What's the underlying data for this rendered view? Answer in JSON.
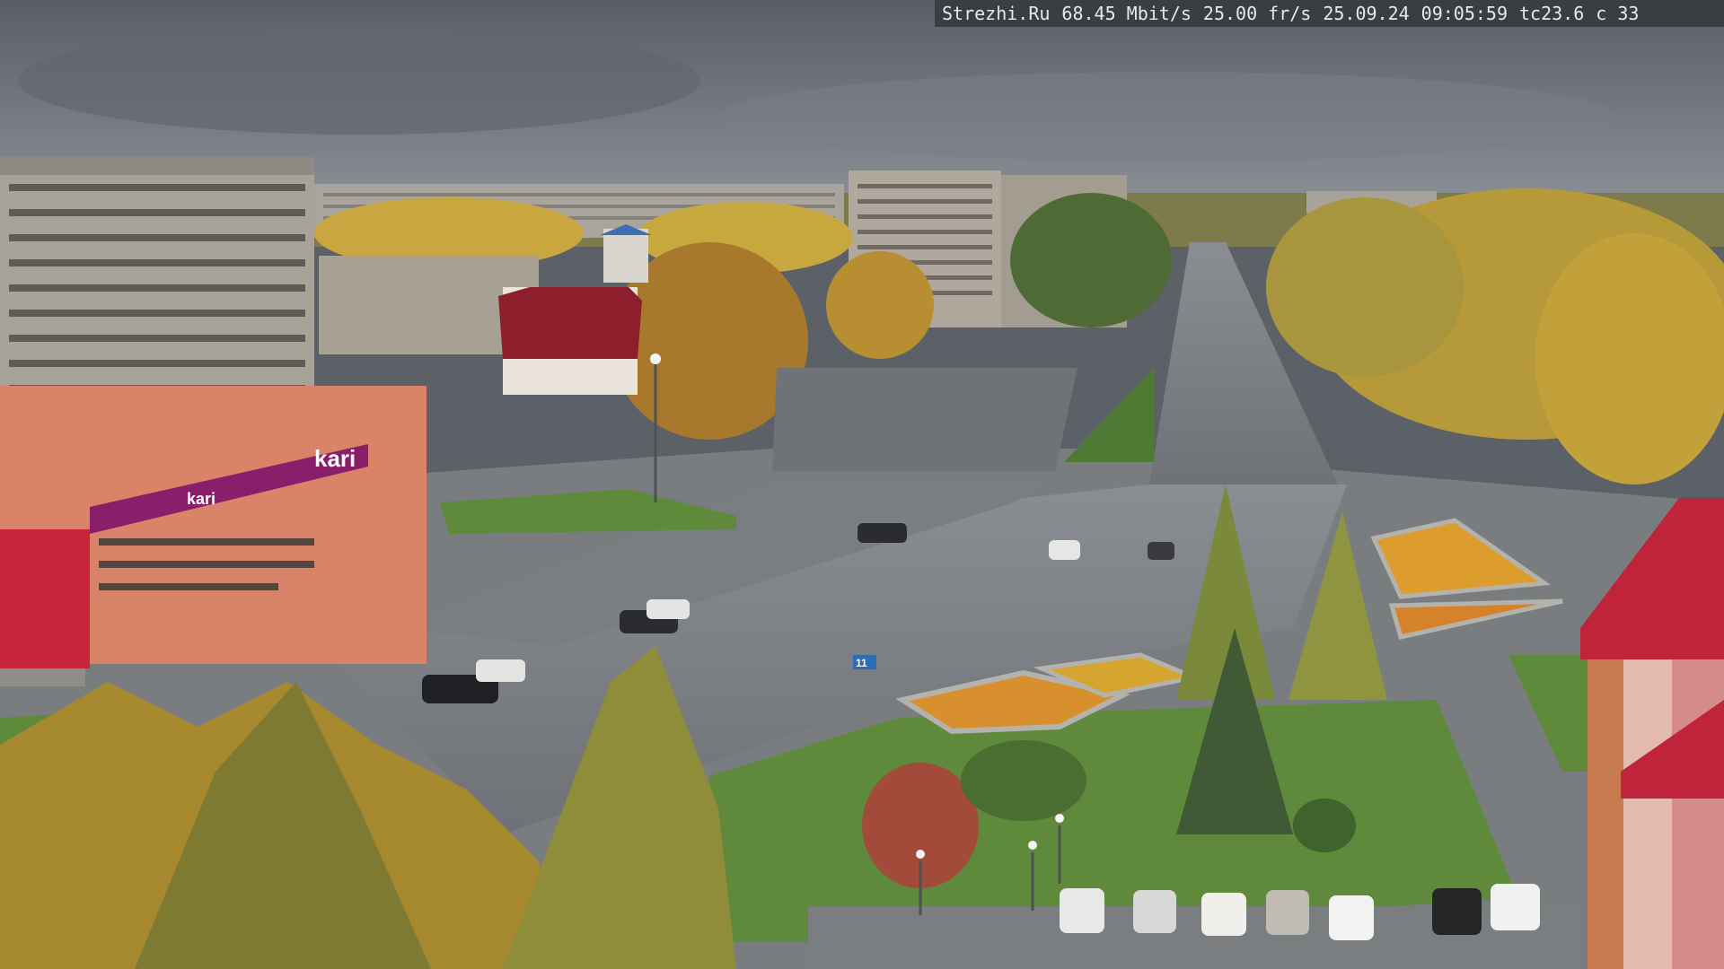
{
  "overlay": {
    "site": "Strezhi.Ru",
    "bitrate": "68.45 Mbit/s",
    "framerate": "25.00 fr/s",
    "date": "25.09.24",
    "time": "09:05:59",
    "temperature": "tc23.6",
    "channel": "c 33"
  },
  "signs": {
    "store_brand": "kari",
    "store_brand_2": "kari",
    "bus_sign": "11"
  },
  "colors": {
    "sky": "#6b7077",
    "asphalt": "#7d8186",
    "grass": "#5f8a3c",
    "autumn_yellow": "#c99a2e",
    "store_magenta": "#8a1e6b",
    "roof_red": "#c0243a"
  }
}
